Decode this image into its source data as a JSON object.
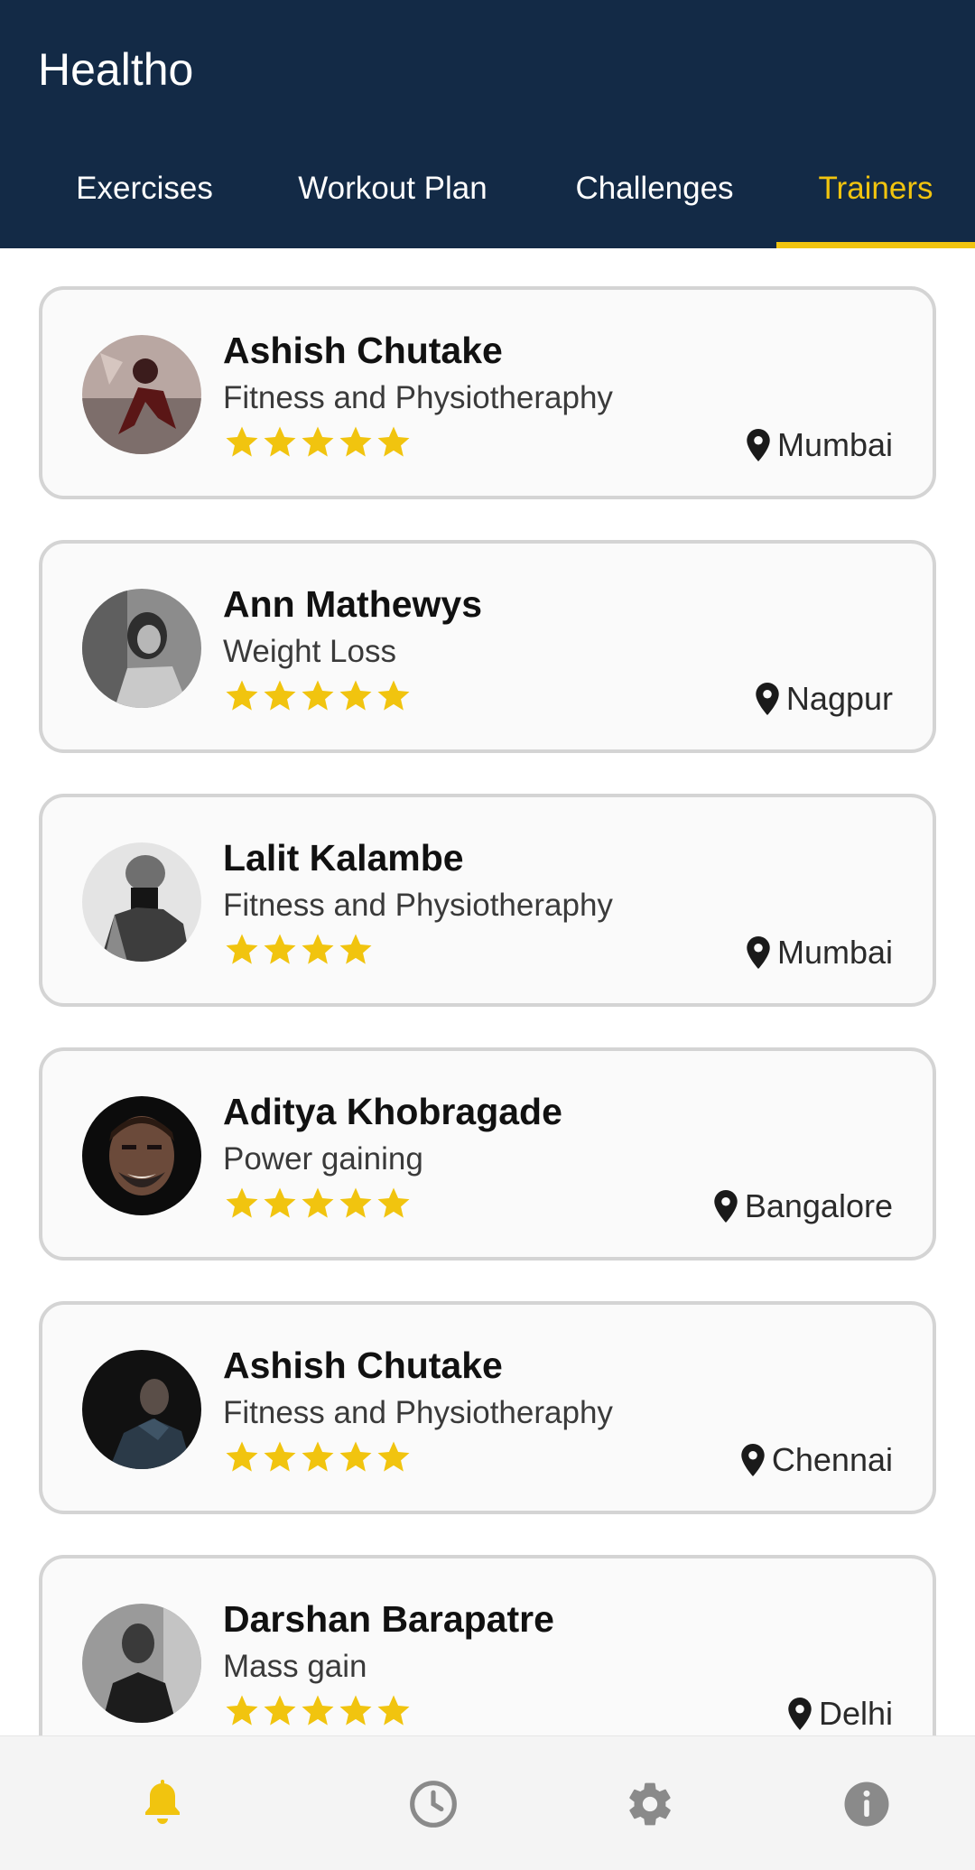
{
  "app": {
    "title": "Healtho"
  },
  "tabs": [
    {
      "label": "Exercises",
      "active": false
    },
    {
      "label": "Workout Plan",
      "active": false
    },
    {
      "label": "Challenges",
      "active": false
    },
    {
      "label": "Trainers",
      "active": true
    }
  ],
  "trainers": [
    {
      "name": "Ashish Chutake",
      "specialty": "Fitness and Physiotheraphy",
      "rating": 5,
      "location": "Mumbai"
    },
    {
      "name": "Ann Mathewys",
      "specialty": "Weight Loss",
      "rating": 5,
      "location": "Nagpur"
    },
    {
      "name": "Lalit Kalambe",
      "specialty": "Fitness and Physiotheraphy",
      "rating": 4,
      "location": "Mumbai"
    },
    {
      "name": "Aditya Khobragade",
      "specialty": "Power gaining",
      "rating": 5,
      "location": "Bangalore"
    },
    {
      "name": "Ashish Chutake",
      "specialty": "Fitness and Physiotheraphy",
      "rating": 5,
      "location": "Chennai"
    },
    {
      "name": "Darshan Barapatre",
      "specialty": "Mass gain",
      "rating": 5,
      "location": "Delhi"
    }
  ],
  "bottom_nav": [
    {
      "icon": "bell-icon",
      "active": true
    },
    {
      "icon": "clock-icon",
      "active": false
    },
    {
      "icon": "gear-icon",
      "active": false
    },
    {
      "icon": "info-icon",
      "active": false
    }
  ],
  "colors": {
    "app_bar": "#132a46",
    "accent": "#f1c40f",
    "card_background": "#fafafa",
    "card_border": "#d4d4d4",
    "nav_inactive": "#8a8a8a"
  }
}
